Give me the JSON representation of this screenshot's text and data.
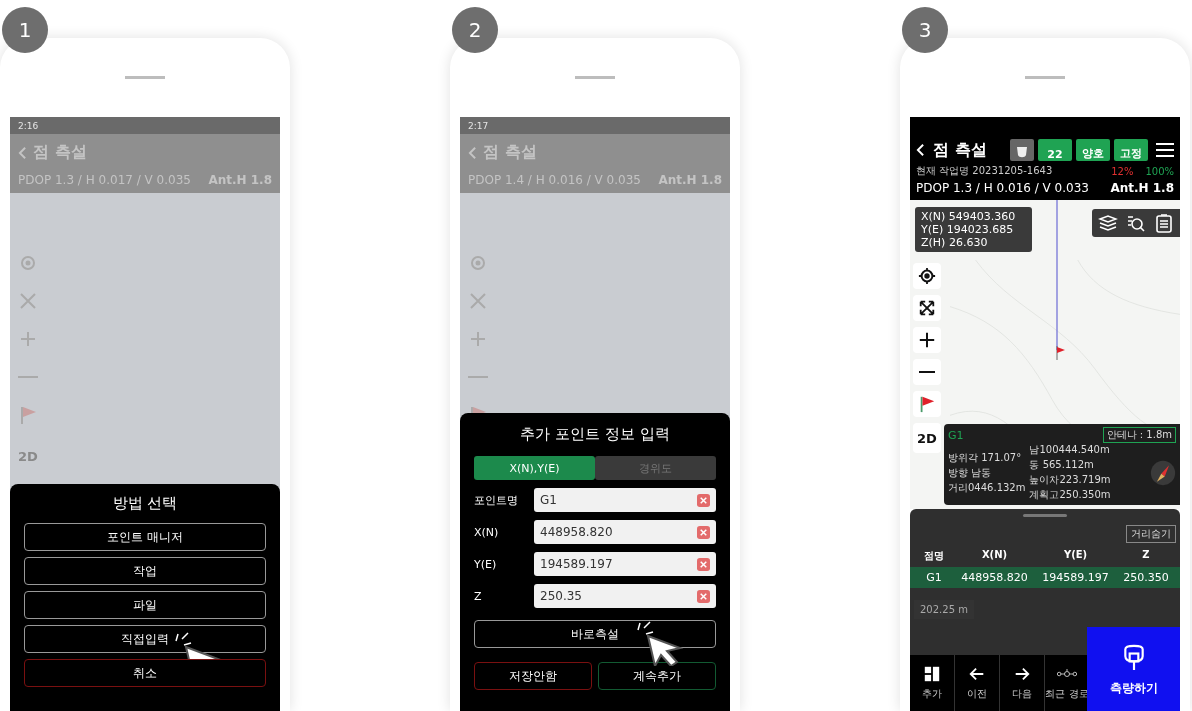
{
  "phones": [
    {
      "kind": "menu",
      "step": "1",
      "background": {
        "status_time": "2:16",
        "title": "점 측설",
        "pdop": "PDOP 1.3 / H 0.017 / V 0.035",
        "antenna": "Ant.H 1.8",
        "view_mode": "2D"
      },
      "dialog": {
        "title": "방법 선택",
        "options": [
          {
            "label": "포인트 매니저",
            "kind": "normal",
            "pointer": false
          },
          {
            "label": "작업",
            "kind": "normal",
            "pointer": false
          },
          {
            "label": "파일",
            "kind": "normal",
            "pointer": false
          },
          {
            "label": "직접입력",
            "kind": "normal",
            "pointer": true
          },
          {
            "label": "취소",
            "kind": "cancel",
            "pointer": false
          }
        ]
      }
    },
    {
      "kind": "input",
      "step": "2",
      "background": {
        "status_time": "2:17",
        "title": "점 측설",
        "pdop": "PDOP 1.4 / H 0.016 / V 0.035",
        "antenna": "Ant.H 1.8"
      },
      "dialog": {
        "title": "추가 포인트 정보 입력",
        "tabs": [
          {
            "label": "X(N),Y(E)",
            "selected": true
          },
          {
            "label": "경위도",
            "selected": false
          }
        ],
        "fields": [
          {
            "label": "포인트명",
            "value": "G1"
          },
          {
            "label": "X(N)",
            "value": "448958.820"
          },
          {
            "label": "Y(E)",
            "value": "194589.197"
          },
          {
            "label": "Z",
            "value": "250.35"
          }
        ],
        "primary": {
          "label": "바로측설",
          "pointer": true
        },
        "buttons": [
          {
            "label": "저장안함",
            "kind": "cancel"
          },
          {
            "label": "계속추가",
            "kind": "confirm"
          }
        ]
      }
    },
    {
      "kind": "main",
      "step": "3",
      "header": {
        "title": "점 측설",
        "badges": [
          {
            "label": "22"
          },
          {
            "label": "양호"
          },
          {
            "label": "고정"
          }
        ],
        "job": "현재 작업명 20231205-1643",
        "battery_a": "12%",
        "battery_b": "100%",
        "pdop": "PDOP 1.3 / H 0.016 / V 0.033",
        "antenna": "Ant.H 1.8"
      },
      "coordinates": [
        "X(N) 549403.360",
        "Y(E) 194023.685",
        "Z(H) 26.630"
      ],
      "view_mode": "2D",
      "info_card": {
        "name": "G1",
        "antenna": "안테나 : 1.8m",
        "left_lines": [
          "방위각 171.07°",
          "방향 남동",
          "거리0446.132m"
        ],
        "right_lines": [
          "남100444.540m",
          "동 565.112m",
          "높이차223.719m",
          "계획고250.350m"
        ]
      },
      "sheet": {
        "hide_button": "거리숨기",
        "columns": [
          "점명",
          "X(N)",
          "Y(E)",
          "Z"
        ],
        "rows": [
          {
            "cells": [
              "G1",
              "448958.820",
              "194589.197",
              "250.350"
            ],
            "selected": true
          }
        ],
        "distance": "202.25 m",
        "nav": [
          {
            "label": "추가",
            "kind": "add"
          },
          {
            "label": "이전",
            "kind": "prev"
          },
          {
            "label": "다음",
            "kind": "next"
          },
          {
            "label": "최근 경로",
            "kind": "route"
          }
        ],
        "action": "측량하기"
      }
    }
  ]
}
